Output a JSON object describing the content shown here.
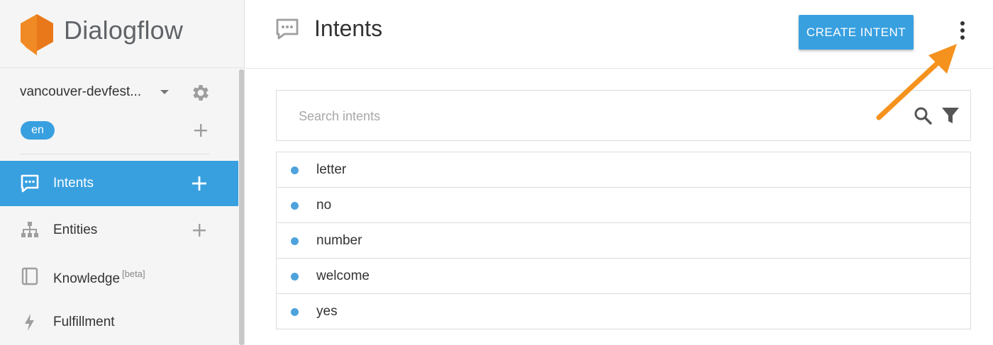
{
  "brand": {
    "name": "Dialogflow"
  },
  "agent": {
    "name": "vancouver-devfest..."
  },
  "language": {
    "code": "en"
  },
  "sidebar": {
    "items": [
      {
        "label": "Intents",
        "active": true,
        "icon": "chat-icon",
        "has_add": true
      },
      {
        "label": "Entities",
        "active": false,
        "icon": "hierarchy-icon",
        "has_add": true
      },
      {
        "label": "Knowledge",
        "badge": "[beta]",
        "active": false,
        "icon": "book-icon",
        "has_add": false
      },
      {
        "label": "Fulfillment",
        "active": false,
        "icon": "bolt-icon",
        "has_add": false
      }
    ]
  },
  "header": {
    "title": "Intents",
    "create_label": "CREATE INTENT"
  },
  "search": {
    "placeholder": "Search intents",
    "value": ""
  },
  "intents": [
    "letter",
    "no",
    "number",
    "welcome",
    "yes"
  ],
  "colors": {
    "accent": "#39a0e0",
    "logo": "#f08a24",
    "arrow": "#f5921e",
    "intent_dot": "#4fa3dc"
  }
}
